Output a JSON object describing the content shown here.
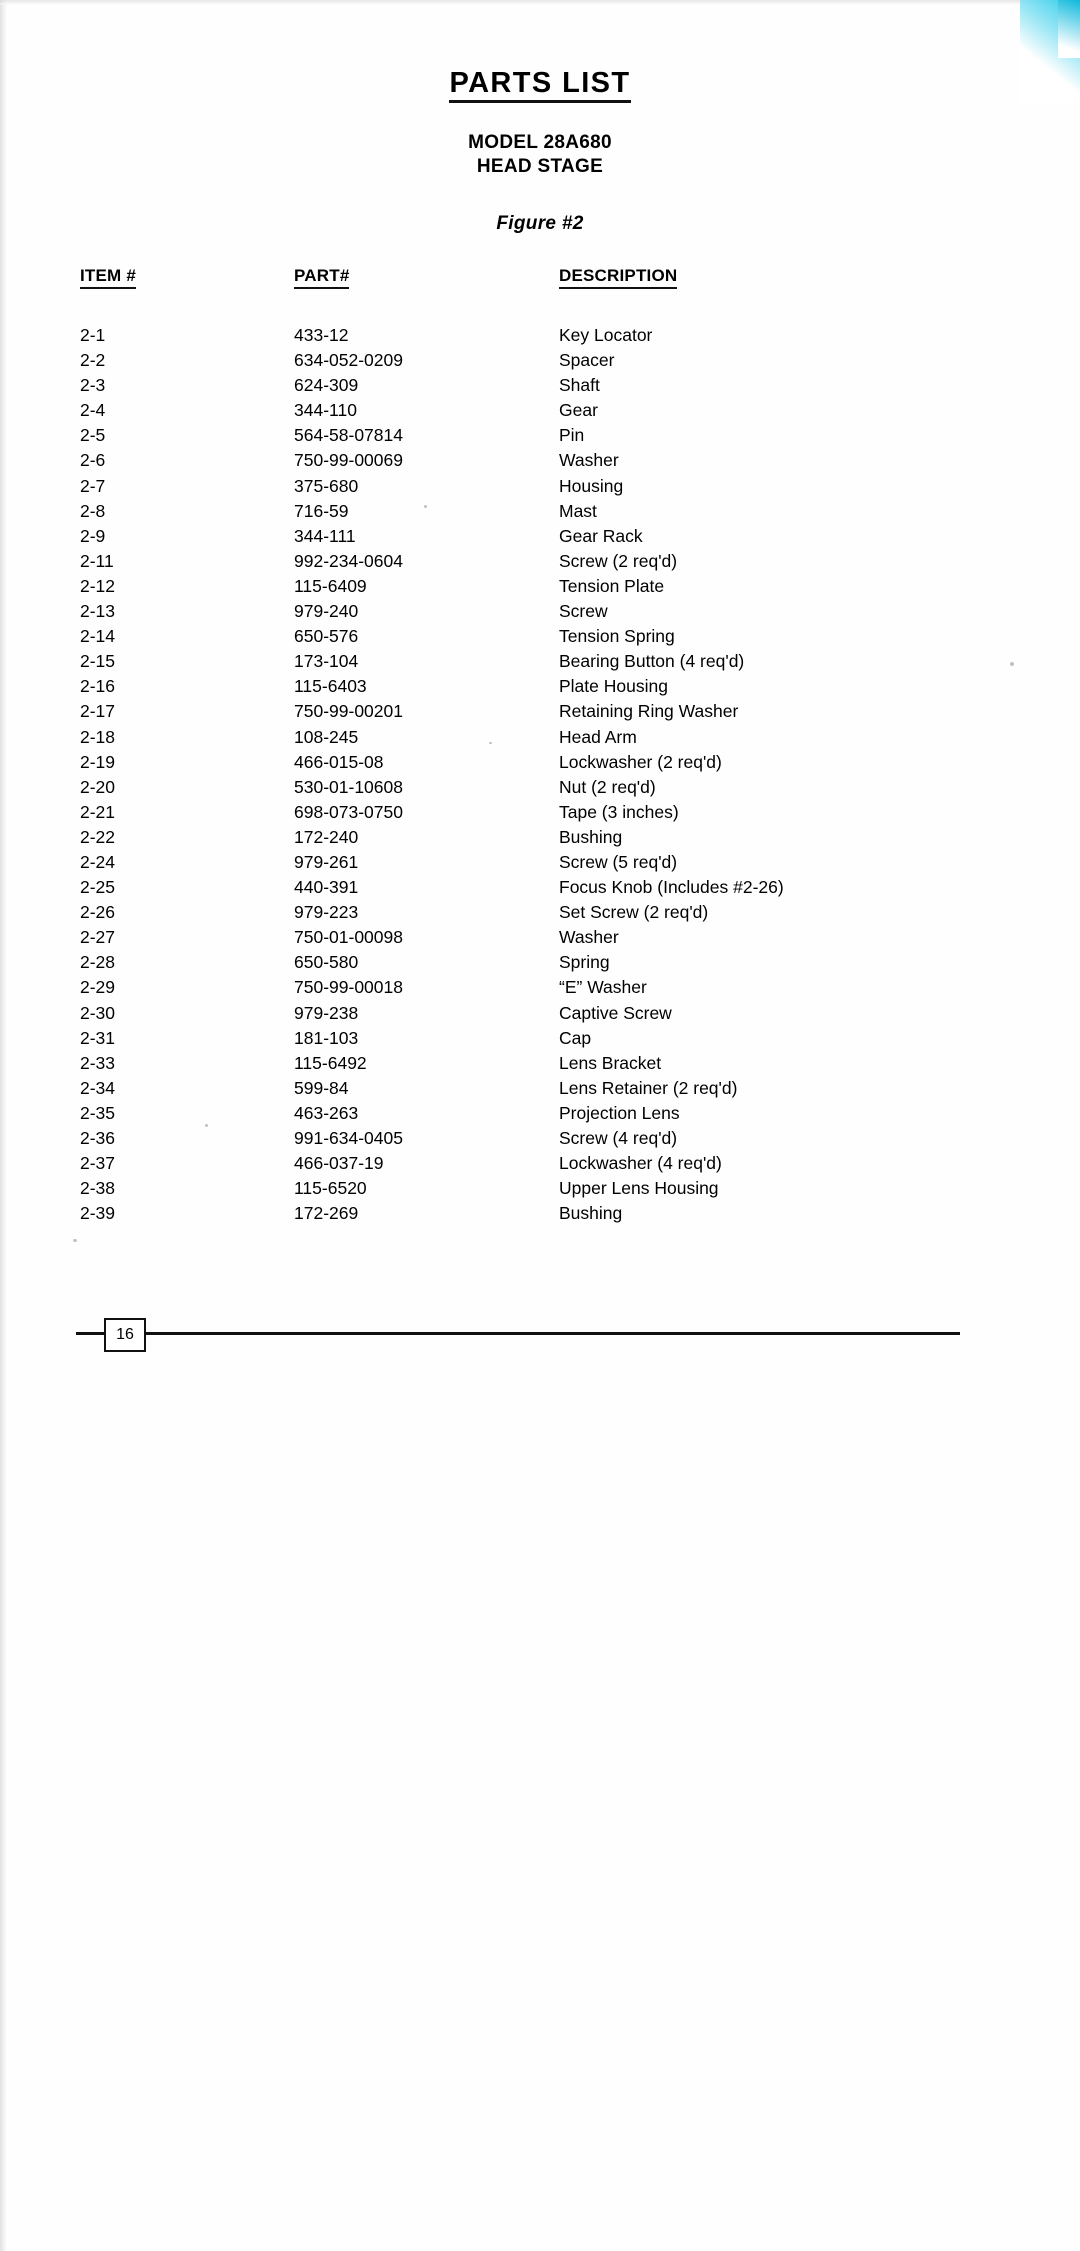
{
  "document": {
    "title": "PARTS LIST",
    "model_line1": "MODEL 28A680",
    "model_line2": "HEAD STAGE",
    "figure": "Figure #2",
    "page_number": "16"
  },
  "table": {
    "headers": {
      "item": "ITEM #",
      "part": "PART#",
      "description": "DESCRIPTION"
    },
    "rows": [
      {
        "item": "2-1",
        "part": "433-12",
        "description": "Key Locator"
      },
      {
        "item": "2-2",
        "part": "634-052-0209",
        "description": "Spacer"
      },
      {
        "item": "2-3",
        "part": "624-309",
        "description": "Shaft"
      },
      {
        "item": "2-4",
        "part": "344-110",
        "description": "Gear"
      },
      {
        "item": "2-5",
        "part": "564-58-07814",
        "description": "Pin"
      },
      {
        "item": "2-6",
        "part": "750-99-00069",
        "description": "Washer"
      },
      {
        "item": "2-7",
        "part": "375-680",
        "description": "Housing"
      },
      {
        "item": "2-8",
        "part": "716-59",
        "description": "Mast"
      },
      {
        "item": "2-9",
        "part": "344-111",
        "description": "Gear Rack"
      },
      {
        "item": "2-11",
        "part": "992-234-0604",
        "description": "Screw (2 req'd)"
      },
      {
        "item": "2-12",
        "part": "115-6409",
        "description": "Tension Plate"
      },
      {
        "item": "2-13",
        "part": "979-240",
        "description": "Screw"
      },
      {
        "item": "2-14",
        "part": "650-576",
        "description": "Tension Spring"
      },
      {
        "item": "2-15",
        "part": "173-104",
        "description": "Bearing Button (4 req'd)"
      },
      {
        "item": "2-16",
        "part": "115-6403",
        "description": "Plate Housing"
      },
      {
        "item": "2-17",
        "part": "750-99-00201",
        "description": "Retaining Ring Washer"
      },
      {
        "item": "2-18",
        "part": "108-245",
        "description": "Head Arm"
      },
      {
        "item": "2-19",
        "part": "466-015-08",
        "description": "Lockwasher (2 req'd)"
      },
      {
        "item": "2-20",
        "part": "530-01-10608",
        "description": "Nut (2 req'd)"
      },
      {
        "item": "2-21",
        "part": "698-073-0750",
        "description": "Tape (3 inches)"
      },
      {
        "item": "2-22",
        "part": "172-240",
        "description": "Bushing"
      },
      {
        "item": "2-24",
        "part": "979-261",
        "description": "Screw (5 req'd)"
      },
      {
        "item": "2-25",
        "part": "440-391",
        "description": "Focus Knob (Includes #2-26)"
      },
      {
        "item": "2-26",
        "part": "979-223",
        "description": "Set Screw (2 req'd)"
      },
      {
        "item": "2-27",
        "part": "750-01-00098",
        "description": "Washer"
      },
      {
        "item": "2-28",
        "part": "650-580",
        "description": "Spring"
      },
      {
        "item": "2-29",
        "part": "750-99-00018",
        "description": "“E” Washer"
      },
      {
        "item": "2-30",
        "part": "979-238",
        "description": "Captive Screw"
      },
      {
        "item": "2-31",
        "part": "181-103",
        "description": "Cap"
      },
      {
        "item": "2-33",
        "part": "115-6492",
        "description": "Lens Bracket"
      },
      {
        "item": "2-34",
        "part": "599-84",
        "description": "Lens Retainer (2 req'd)"
      },
      {
        "item": "2-35",
        "part": "463-263",
        "description": "Projection Lens"
      },
      {
        "item": "2-36",
        "part": "991-634-0405",
        "description": "Screw (4 req'd)"
      },
      {
        "item": "2-37",
        "part": "466-037-19",
        "description": "Lockwasher (4 req'd)"
      },
      {
        "item": "2-38",
        "part": "115-6520",
        "description": "Upper Lens Housing"
      },
      {
        "item": "2-39",
        "part": "172-269",
        "description": "Bushing"
      }
    ]
  }
}
